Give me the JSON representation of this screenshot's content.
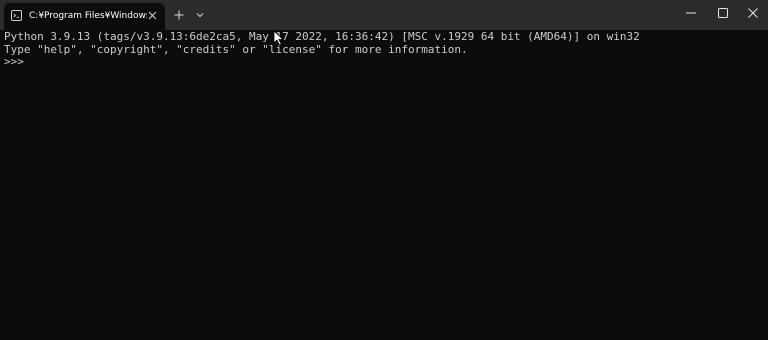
{
  "tab": {
    "title": "C:¥Program Files¥WindowsAp",
    "icon": "terminal-icon"
  },
  "titlebar": {
    "new_tab_icon": "plus-icon",
    "dropdown_icon": "chevron-down-icon",
    "minimize_icon": "minimize-icon",
    "maximize_icon": "maximize-icon",
    "close_icon": "close-icon"
  },
  "terminal": {
    "lines": [
      "Python 3.9.13 (tags/v3.9.13:6de2ca5, May 17 2022, 16:36:42) [MSC v.1929 64 bit (AMD64)] on win32",
      "Type \"help\", \"copyright\", \"credits\" or \"license\" for more information.",
      ">>>"
    ]
  },
  "colors": {
    "titlebar_bg": "#2b2b2b",
    "terminal_bg": "#0c0c0c",
    "terminal_text": "#cccccc"
  }
}
